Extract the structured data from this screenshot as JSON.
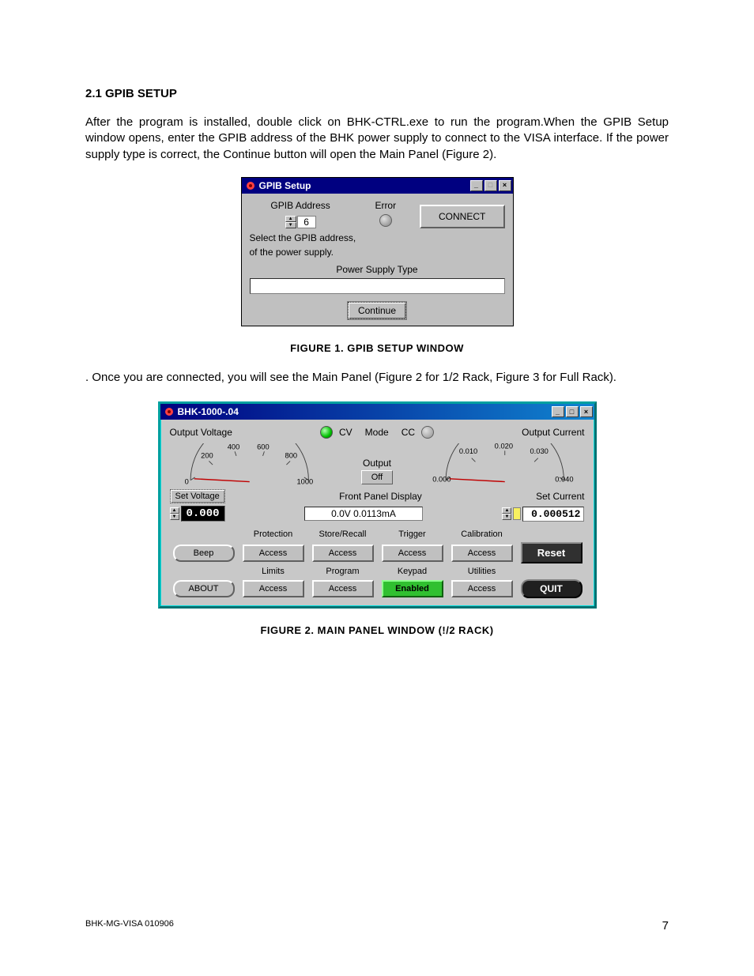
{
  "section": {
    "heading": "2.1 GPIB SETUP"
  },
  "para1": "After the program is installed, double click on BHK-CTRL.exe to run the program.When the GPIB Setup window opens, enter the GPIB address of the BHK power supply to connect to the VISA interface. If the power supply type is correct, the Continue button will open the Main Panel (Figure 2).",
  "fig1_caption": "FIGURE 1.    GPIB SETUP WINDOW",
  "para2": ". Once you are connected, you will see the Main Panel (Figure 2 for 1/2 Rack, Figure 3 for Full Rack).",
  "fig2_caption": "FIGURE 2.    MAIN PANEL WINDOW (!/2 RACK)",
  "footer": {
    "left": "BHK-MG-VISA 010906",
    "right": "7"
  },
  "win1": {
    "title": "GPIB Setup",
    "gpib_label": "GPIB Address",
    "gpib_value": "6",
    "error_label": "Error",
    "connect": "CONNECT",
    "note1": "Select the GPIB address,",
    "note2": "of the power supply.",
    "ps_type": "Power Supply Type",
    "continue": "Continue"
  },
  "win2": {
    "title": "BHK-1000-.04",
    "output_voltage": "Output Voltage",
    "output_current": "Output Current",
    "cv": "CV",
    "mode": "Mode",
    "cc": "CC",
    "output_label": "Output",
    "off": "Off",
    "set_voltage": "Set Voltage",
    "set_current": "Set Current",
    "voltage_value": "0.000",
    "current_value": "0.000512",
    "fp_label": "Front Panel Display",
    "fp_value": "0.0V 0.0113mA",
    "v_ticks": [
      "0",
      "200",
      "400",
      "600",
      "800",
      "1000"
    ],
    "c_ticks": [
      "0.000",
      "0.010",
      "0.020",
      "0.030",
      "0.040"
    ],
    "headers": {
      "protection": "Protection",
      "store": "Store/Recall",
      "trigger": "Trigger",
      "calibration": "Calibration",
      "limits": "Limits",
      "program": "Program",
      "keypad": "Keypad",
      "utilities": "Utilities"
    },
    "buttons": {
      "beep": "Beep",
      "access": "Access",
      "reset": "Reset",
      "about": "ABOUT",
      "enabled": "Enabled",
      "quit": "QUIT"
    }
  }
}
